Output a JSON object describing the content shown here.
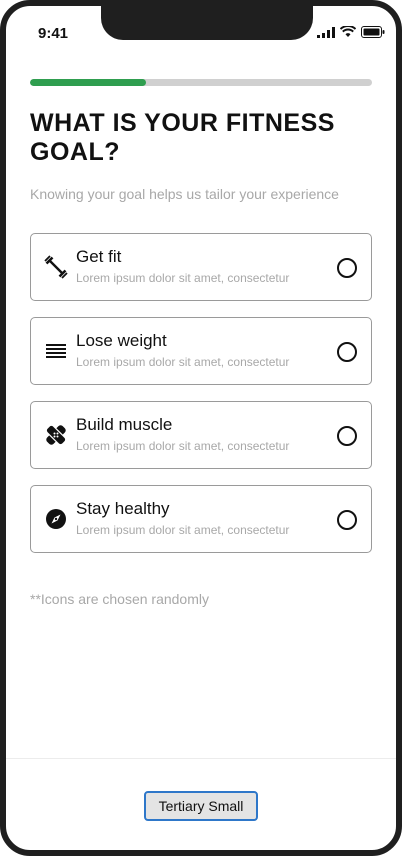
{
  "status_bar": {
    "time": "9:41",
    "icons": [
      "signal-icon",
      "wifi-icon",
      "battery-icon"
    ]
  },
  "progress": {
    "fraction": 0.34,
    "color": "#2f9e4f"
  },
  "header": {
    "title": "WHAT IS YOUR FITNESS GOAL?",
    "subtitle": "Knowing your goal helps us tailor your experience"
  },
  "options": [
    {
      "label": "Get fit",
      "description": "Lorem ipsum dolor sit amet, consectetur",
      "icon": "dumbbell-icon",
      "selected": false
    },
    {
      "label": "Lose weight",
      "description": "Lorem ipsum dolor sit amet, consectetur",
      "icon": "lines-icon",
      "selected": false
    },
    {
      "label": "Build muscle",
      "description": "Lorem ipsum dolor sit amet, consectetur",
      "icon": "bandage-icon",
      "selected": false
    },
    {
      "label": "Stay healthy",
      "description": "Lorem ipsum dolor sit amet, consectetur",
      "icon": "compass-icon",
      "selected": false
    }
  ],
  "note": "**Icons are chosen randomly",
  "footer": {
    "button_label": "Tertiary Small",
    "button_border": "#2e77c9"
  }
}
